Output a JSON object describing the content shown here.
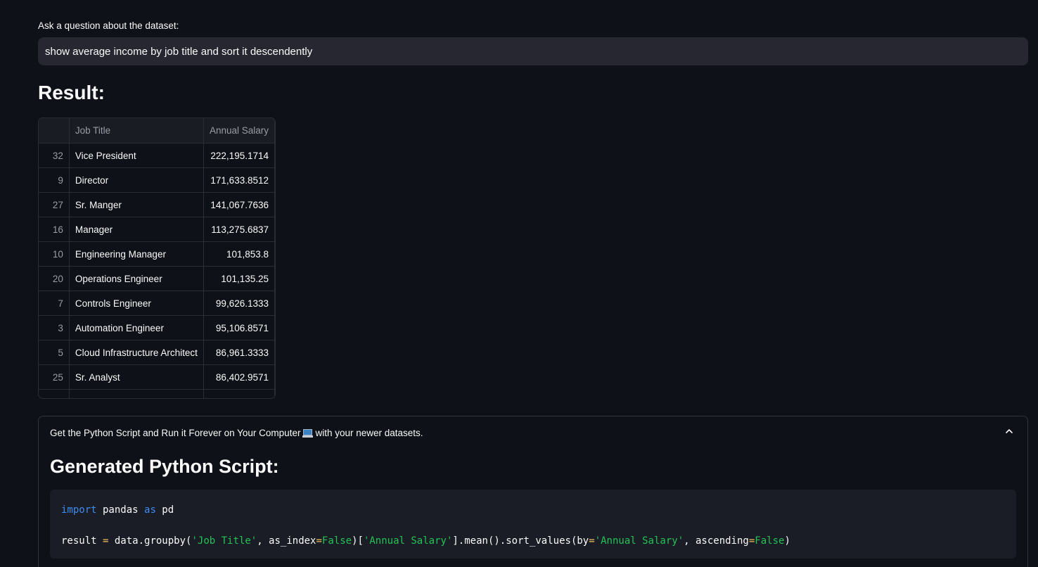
{
  "question": {
    "label": "Ask a question about the dataset:",
    "value": "show average income by job title and sort it descendently"
  },
  "result": {
    "heading": "Result:",
    "columns": [
      "",
      "Job Title",
      "Annual Salary"
    ],
    "rows": [
      {
        "index": "32",
        "title": "Vice President",
        "salary": "222,195.1714"
      },
      {
        "index": "9",
        "title": "Director",
        "salary": "171,633.8512"
      },
      {
        "index": "27",
        "title": "Sr. Manger",
        "salary": "141,067.7636"
      },
      {
        "index": "16",
        "title": "Manager",
        "salary": "113,275.6837"
      },
      {
        "index": "10",
        "title": "Engineering Manager",
        "salary": "101,853.8"
      },
      {
        "index": "20",
        "title": "Operations Engineer",
        "salary": "101,135.25"
      },
      {
        "index": "7",
        "title": "Controls Engineer",
        "salary": "99,626.1333"
      },
      {
        "index": "3",
        "title": "Automation Engineer",
        "salary": "95,106.8571"
      },
      {
        "index": "5",
        "title": "Cloud Infrastructure Architect",
        "salary": "86,961.3333"
      },
      {
        "index": "25",
        "title": "Sr. Analyst",
        "salary": "86,402.9571"
      }
    ]
  },
  "expander": {
    "header_before_icon": "Get the Python Script and Run it Forever on Your Computer",
    "header_after_icon": "with your newer datasets.",
    "icon": "laptop-icon",
    "expanded": true,
    "script_heading": "Generated Python Script:",
    "code_line1": {
      "kw1": "import",
      "mod": " pandas ",
      "kw2": "as",
      "alias": " pd"
    },
    "code_line2": {
      "p1": "result ",
      "eq": "=",
      "p2": " data.groupby(",
      "s1": "'Job Title'",
      "p3": ", as_index",
      "eq2": "=",
      "b1": "False",
      "p4": ")[",
      "s2": "'Annual Salary'",
      "p5": "].mean().sort_values(by",
      "eq3": "=",
      "s3": "'Annual Salary'",
      "p6": ", ascending",
      "eq4": "=",
      "b2": "False",
      "p7": ")"
    }
  },
  "colors": {
    "background": "#0e1117",
    "input_bg": "#262730",
    "keyword": "#3d8cf0",
    "string": "#21c354"
  }
}
